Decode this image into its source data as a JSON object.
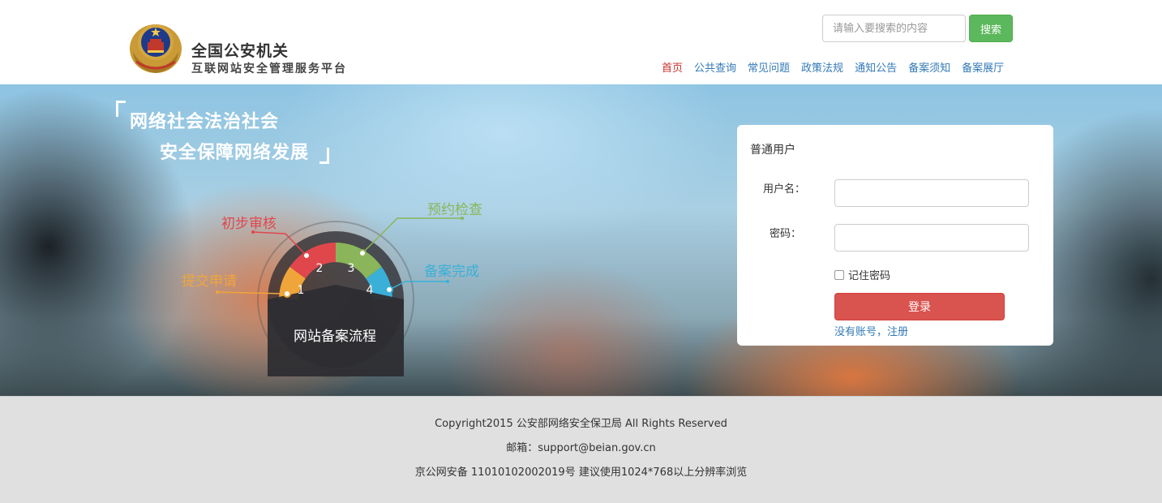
{
  "header": {
    "site_title": "全国公安机关",
    "site_subtitle": "互联网站安全管理服务平台",
    "search": {
      "placeholder": "请输入要搜索的内容",
      "button_label": "搜索"
    },
    "nav": [
      {
        "label": "首页",
        "active": true
      },
      {
        "label": "公共查询"
      },
      {
        "label": "常见问题"
      },
      {
        "label": "政策法规"
      },
      {
        "label": "通知公告"
      },
      {
        "label": "备案须知"
      },
      {
        "label": "备案展厅"
      }
    ]
  },
  "banner": {
    "slogan_line1": "网络社会法治社会",
    "slogan_line2": "安全保障网络发展",
    "process": {
      "center_label": "网站备案流程",
      "steps": [
        {
          "number": "1",
          "label": "提交申请",
          "color": "#f0a53a"
        },
        {
          "number": "2",
          "label": "初步审核",
          "color": "#e0474c"
        },
        {
          "number": "3",
          "label": "预约检查",
          "color": "#8ab55a"
        },
        {
          "number": "4",
          "label": "备案完成",
          "color": "#3ab0d8"
        }
      ]
    }
  },
  "login": {
    "title": "普通用户",
    "username_label": "用户名：",
    "password_label": "密码：",
    "remember_label": "记住密码",
    "submit_label": "登录",
    "register_link": "没有账号，注册"
  },
  "footer": {
    "copyright": "Copyright2015 公安部网络安全保卫局 All Rights Reserved",
    "email": "邮箱：support@beian.gov.cn",
    "icp": "京公网安备 11010102002019号 建议使用1024*768以上分辨率浏览"
  }
}
